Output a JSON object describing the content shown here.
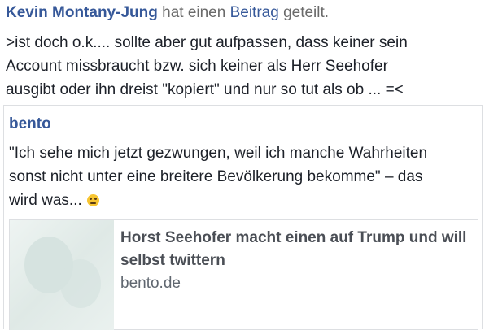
{
  "header": {
    "author": "Kevin Montany-Jung",
    "action_prefix": "hat einen",
    "object_link": "Beitrag",
    "action_suffix": "geteilt."
  },
  "post": {
    "lines": [
      ">ist doch o.k.... sollte aber gut aufpassen, dass keiner sein",
      "Account missbraucht bzw. sich keiner als Herr Seehofer",
      "ausgibt oder ihn dreist \"kopiert\" und nur so tut als ob ... =<"
    ]
  },
  "shared_post": {
    "page_name": "bento",
    "lines": [
      "\"Ich sehe mich jetzt gezwungen, weil ich manche Wahrheiten",
      "sonst nicht unter eine breitere Bevölkerung bekomme\" – das",
      "wird was..."
    ],
    "emoji": "eye-roll-emoji"
  },
  "link_card": {
    "title": "Horst Seehofer macht einen auf Trump und will selbst twittern",
    "domain": "bento.de"
  }
}
